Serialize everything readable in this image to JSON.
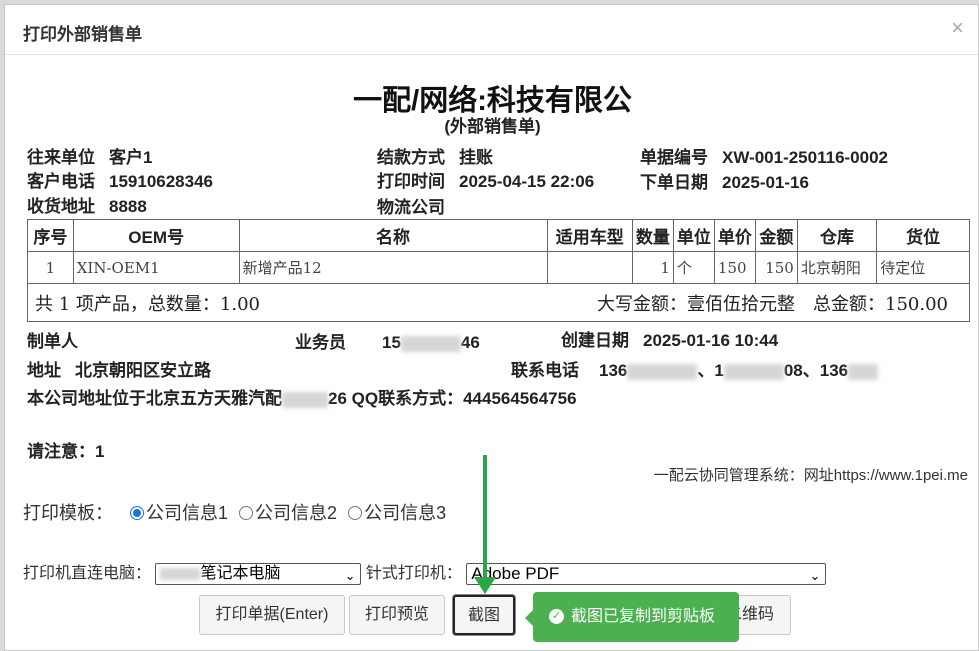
{
  "dialog": {
    "title": "打印外部销售单",
    "close": "×"
  },
  "header": {
    "company": "一配/网络:科技有限公",
    "subtitle": "(外部销售单)"
  },
  "info": [
    {
      "label": "往来单位",
      "value": "客户1"
    },
    {
      "label": "客户电话",
      "value": "15910628346"
    },
    {
      "label": "收货地址",
      "value": "8888"
    },
    {
      "label": "结款方式",
      "value": "挂账"
    },
    {
      "label": "打印时间",
      "value": "2025-04-15 22:06"
    },
    {
      "label": "物流公司",
      "value": ""
    },
    {
      "label": "单据编号",
      "value": "XW-001-250116-0002"
    },
    {
      "label": "下单日期",
      "value": "2025-01-16"
    }
  ],
  "table": {
    "headers": [
      "序号",
      "OEM号",
      "名称",
      "适用车型",
      "数量",
      "单位",
      "单价",
      "金额",
      "仓库",
      "货位"
    ],
    "rows": [
      [
        "1",
        "XIN-OEM1",
        "新增产品12",
        "",
        "1",
        "个",
        "150",
        "150",
        "北京朝阳",
        "待定位"
      ]
    ],
    "summary_left": "共 1 项产品，总数量：1.00",
    "summary_right": "大写金额：壹佰伍拾元整　总金额：150.00"
  },
  "footer": {
    "maker_label": "制单人",
    "sales_label": "业务员",
    "sales_value": "15",
    "sales_value_tail": "46",
    "created_label": "创建日期",
    "created_value": "2025-01-16 10:44",
    "address_label": "地址",
    "address_value": "北京朝阳区安立路",
    "contact_label": "联系电话",
    "contact_value_a": "136",
    "contact_sep1": "、1",
    "contact_value_b": "08",
    "contact_sep2": "、136",
    "company_addr_head": "本公司地址位于北京五方天雅汽配",
    "company_addr_tail": "26 QQ联系方式：444564564756",
    "notice": "请注意：1",
    "system_note": "一配云协同管理系统：网址https://www.1pei.me"
  },
  "template": {
    "label": "打印模板：",
    "options": [
      "公司信息1",
      "公司信息2",
      "公司信息3"
    ],
    "selected": "公司信息1"
  },
  "printer": {
    "direct_label": "打印机直连电脑：",
    "direct_value": "笔记本电脑",
    "needle_label": "针式打印机：",
    "needle_value": "Adobe PDF"
  },
  "buttons": {
    "print": "打印单据(Enter)",
    "preview": "打印预览",
    "screenshot": "截图",
    "qrcode": "二维码"
  },
  "toast": {
    "message": "截图已复制到剪贴板"
  },
  "colors": {
    "toast": "#4caf50",
    "arrow": "#28a745",
    "radio": "#1a73e8"
  }
}
